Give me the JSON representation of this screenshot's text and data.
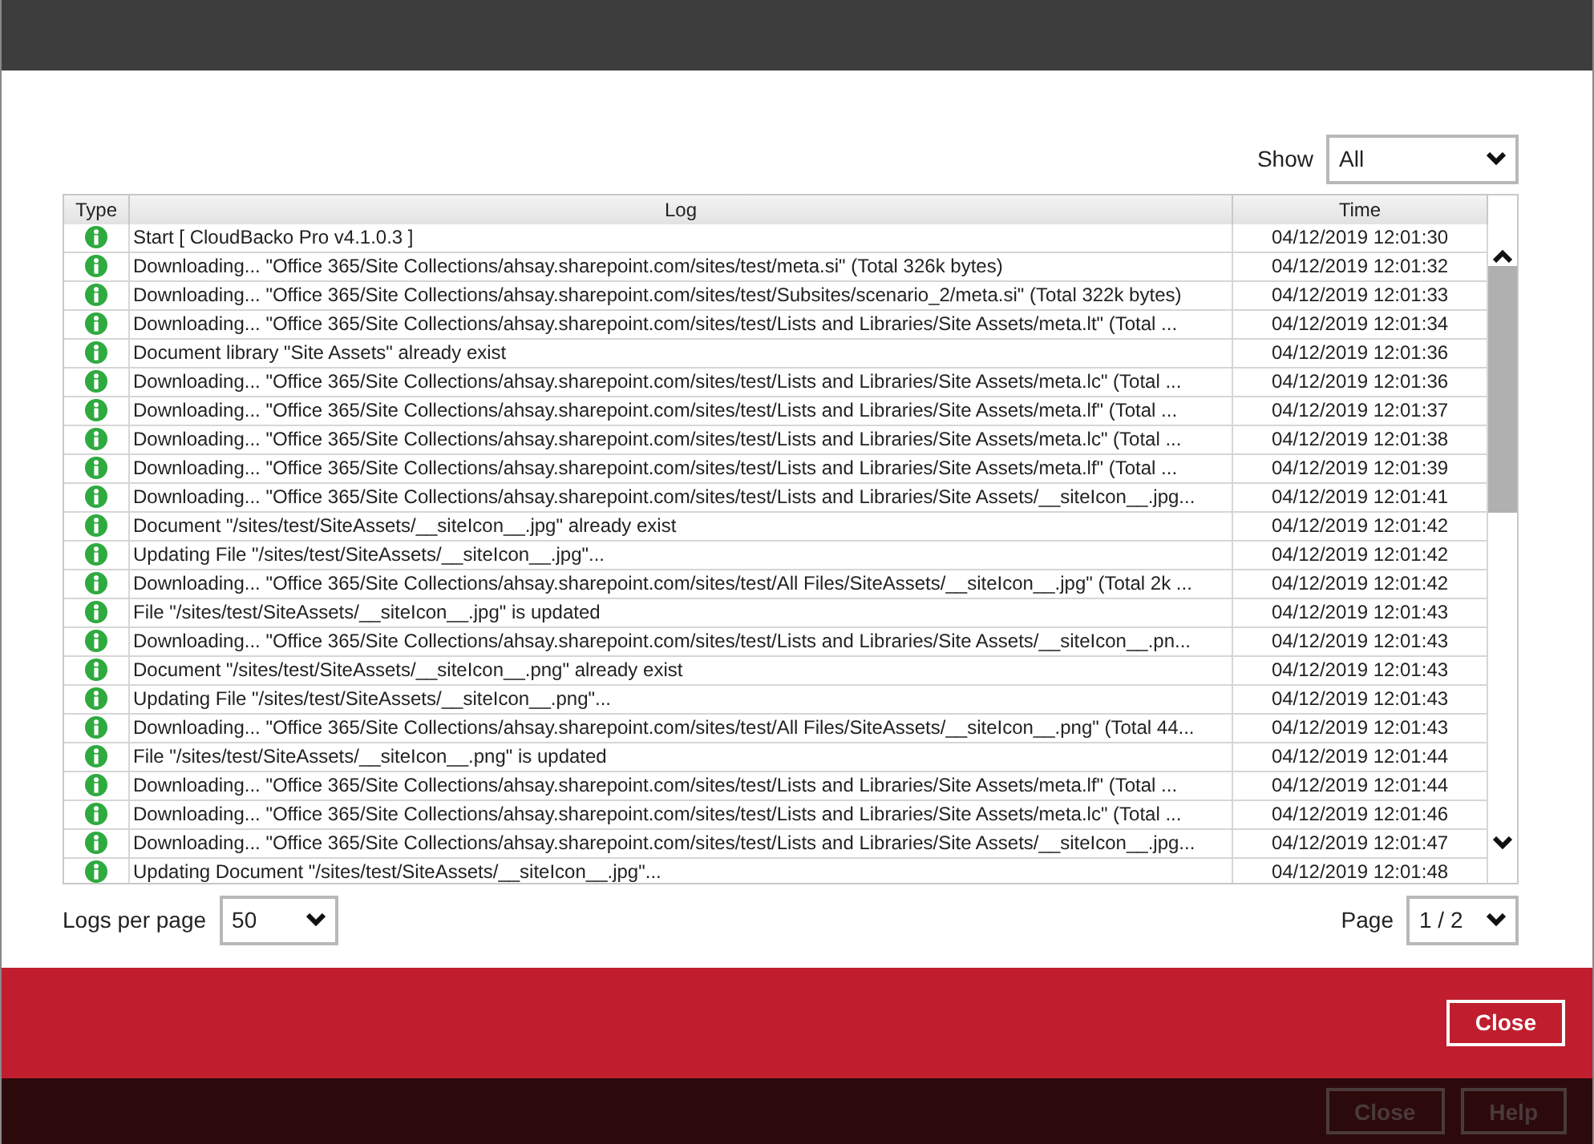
{
  "filter": {
    "label": "Show",
    "value": "All"
  },
  "table": {
    "columns": [
      "Type",
      "Log",
      "Time"
    ],
    "rows": [
      {
        "kind": "info",
        "log": "Start [ CloudBacko Pro v4.1.0.3 ]",
        "time": "04/12/2019 12:01:30"
      },
      {
        "kind": "info",
        "log": "Downloading... \"Office 365/Site Collections/ahsay.sharepoint.com/sites/test/meta.si\" (Total 326k bytes)",
        "time": "04/12/2019 12:01:32"
      },
      {
        "kind": "info",
        "log": "Downloading... \"Office 365/Site Collections/ahsay.sharepoint.com/sites/test/Subsites/scenario_2/meta.si\" (Total 322k bytes)",
        "time": "04/12/2019 12:01:33"
      },
      {
        "kind": "info",
        "log": "Downloading... \"Office 365/Site Collections/ahsay.sharepoint.com/sites/test/Lists and Libraries/Site Assets/meta.lt\" (Total ...",
        "time": "04/12/2019 12:01:34"
      },
      {
        "kind": "info",
        "log": "Document library \"Site Assets\" already exist",
        "time": "04/12/2019 12:01:36"
      },
      {
        "kind": "info",
        "log": "Downloading... \"Office 365/Site Collections/ahsay.sharepoint.com/sites/test/Lists and Libraries/Site Assets/meta.lc\" (Total ...",
        "time": "04/12/2019 12:01:36"
      },
      {
        "kind": "info",
        "log": "Downloading... \"Office 365/Site Collections/ahsay.sharepoint.com/sites/test/Lists and Libraries/Site Assets/meta.lf\" (Total ...",
        "time": "04/12/2019 12:01:37"
      },
      {
        "kind": "info",
        "log": "Downloading... \"Office 365/Site Collections/ahsay.sharepoint.com/sites/test/Lists and Libraries/Site Assets/meta.lc\" (Total ...",
        "time": "04/12/2019 12:01:38"
      },
      {
        "kind": "info",
        "log": "Downloading... \"Office 365/Site Collections/ahsay.sharepoint.com/sites/test/Lists and Libraries/Site Assets/meta.lf\" (Total ...",
        "time": "04/12/2019 12:01:39"
      },
      {
        "kind": "info",
        "log": "Downloading... \"Office 365/Site Collections/ahsay.sharepoint.com/sites/test/Lists and Libraries/Site Assets/__siteIcon__.jpg...",
        "time": "04/12/2019 12:01:41"
      },
      {
        "kind": "info",
        "log": "Document \"/sites/test/SiteAssets/__siteIcon__.jpg\" already exist",
        "time": "04/12/2019 12:01:42"
      },
      {
        "kind": "info",
        "log": "Updating File \"/sites/test/SiteAssets/__siteIcon__.jpg\"...",
        "time": "04/12/2019 12:01:42"
      },
      {
        "kind": "info",
        "log": "Downloading... \"Office 365/Site Collections/ahsay.sharepoint.com/sites/test/All Files/SiteAssets/__siteIcon__.jpg\" (Total 2k ...",
        "time": "04/12/2019 12:01:42"
      },
      {
        "kind": "info",
        "log": "File \"/sites/test/SiteAssets/__siteIcon__.jpg\" is updated",
        "time": "04/12/2019 12:01:43"
      },
      {
        "kind": "info",
        "log": "Downloading... \"Office 365/Site Collections/ahsay.sharepoint.com/sites/test/Lists and Libraries/Site Assets/__siteIcon__.pn...",
        "time": "04/12/2019 12:01:43"
      },
      {
        "kind": "info",
        "log": "Document \"/sites/test/SiteAssets/__siteIcon__.png\" already exist",
        "time": "04/12/2019 12:01:43"
      },
      {
        "kind": "info",
        "log": "Updating File \"/sites/test/SiteAssets/__siteIcon__.png\"...",
        "time": "04/12/2019 12:01:43"
      },
      {
        "kind": "info",
        "log": "Downloading... \"Office 365/Site Collections/ahsay.sharepoint.com/sites/test/All Files/SiteAssets/__siteIcon__.png\" (Total 44...",
        "time": "04/12/2019 12:01:43"
      },
      {
        "kind": "info",
        "log": "File \"/sites/test/SiteAssets/__siteIcon__.png\" is updated",
        "time": "04/12/2019 12:01:44"
      },
      {
        "kind": "info",
        "log": "Downloading... \"Office 365/Site Collections/ahsay.sharepoint.com/sites/test/Lists and Libraries/Site Assets/meta.lf\" (Total ...",
        "time": "04/12/2019 12:01:44"
      },
      {
        "kind": "info",
        "log": "Downloading... \"Office 365/Site Collections/ahsay.sharepoint.com/sites/test/Lists and Libraries/Site Assets/meta.lc\" (Total ...",
        "time": "04/12/2019 12:01:46"
      },
      {
        "kind": "info",
        "log": "Downloading... \"Office 365/Site Collections/ahsay.sharepoint.com/sites/test/Lists and Libraries/Site Assets/__siteIcon__.jpg...",
        "time": "04/12/2019 12:01:47"
      },
      {
        "kind": "info",
        "log": "Updating Document \"/sites/test/SiteAssets/__siteIcon__.jpg\"...",
        "time": "04/12/2019 12:01:48"
      }
    ]
  },
  "logs_per_page": {
    "label": "Logs per page",
    "value": "50"
  },
  "page": {
    "label": "Page",
    "value": "1 / 2"
  },
  "dialog_buttons": [
    {
      "label": "Close",
      "disabled": false
    }
  ],
  "background_buttons": [
    {
      "label": "Close",
      "disabled": true
    },
    {
      "label": "Help",
      "disabled": true
    }
  ]
}
